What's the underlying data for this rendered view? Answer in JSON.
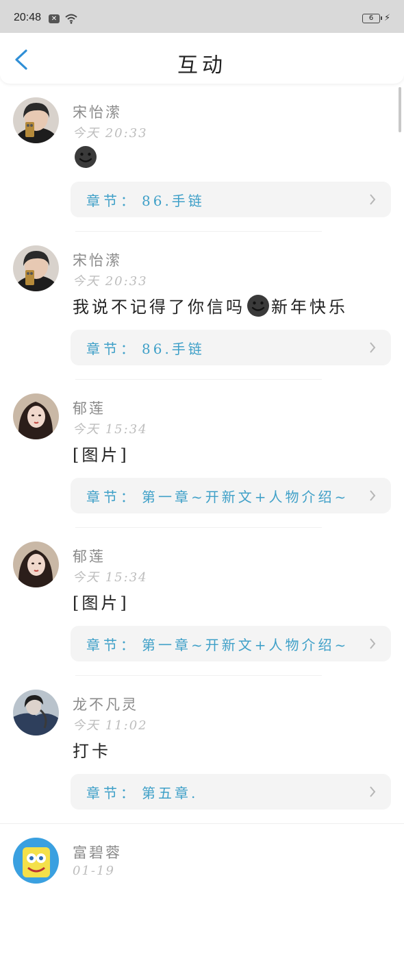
{
  "status_bar": {
    "time": "20:48",
    "battery": "6"
  },
  "header": {
    "title": "互动"
  },
  "colors": {
    "accent": "#3fa0c8",
    "back_arrow": "#2f8fd6"
  },
  "items": [
    {
      "user": "宋怡潆",
      "time": "今天 20:33",
      "content_before": "",
      "emoji": "dark-smile-emoji",
      "content_after": "",
      "chapter_prefix": "章节：",
      "chapter_title": "86.手链",
      "avatar": "avatar-photo"
    },
    {
      "user": "宋怡潆",
      "time": "今天 20:33",
      "content_before": "我说不记得了你信吗",
      "emoji": "dark-smile-emoji",
      "content_after": "新年快乐",
      "chapter_prefix": "章节：",
      "chapter_title": "86.手链",
      "avatar": "avatar-photo"
    },
    {
      "user": "郁莲",
      "time": "今天 15:34",
      "content_before": "[图片]",
      "emoji": "",
      "content_after": "",
      "chapter_prefix": "章节：",
      "chapter_title": "第一章~开新文+人物介绍~",
      "avatar": "avatar-photo"
    },
    {
      "user": "郁莲",
      "time": "今天 15:34",
      "content_before": "[图片]",
      "emoji": "",
      "content_after": "",
      "chapter_prefix": "章节：",
      "chapter_title": "第一章~开新文+人物介绍~",
      "avatar": "avatar-photo"
    },
    {
      "user": "龙不凡灵",
      "time": "今天 11:02",
      "content_before": "打卡",
      "emoji": "",
      "content_after": "",
      "chapter_prefix": "章节：",
      "chapter_title": "第五章.",
      "avatar": "avatar-photo"
    },
    {
      "user": "富碧蓉",
      "time": "01-19",
      "avatar": "cartoon-avatar"
    }
  ]
}
